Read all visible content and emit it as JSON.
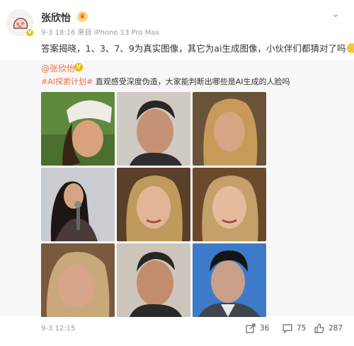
{
  "user": {
    "name": "张欣怡",
    "meta": "9-3 18:16  来自 iPhone 13 Pro Max"
  },
  "post": {
    "text": "答案揭晓，1、3、7、9为真实图像，其它为ai生成图像，小伙伴们都猜对了吗"
  },
  "repost": {
    "user": "@张欣怡",
    "hashtag": "#AI探索计划#",
    "text": " 直观感受深度伪造，大家能判断出哪些是AI生成的人脸吗"
  },
  "footer": {
    "time": "9-3 12:15",
    "reposts": "36",
    "comments": "75",
    "likes": "287"
  },
  "icons": [
    "crown-icon",
    "verified-icon",
    "more-chevron-icon",
    "share-icon",
    "comment-icon",
    "like-icon"
  ]
}
